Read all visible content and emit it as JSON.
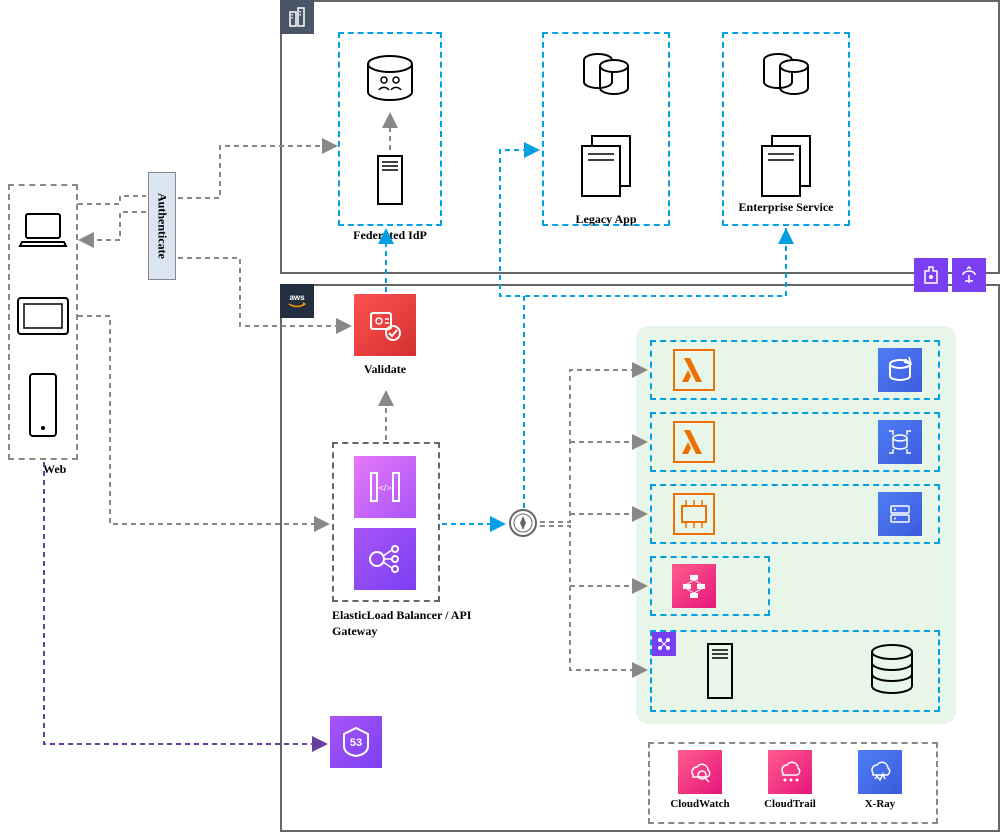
{
  "clients": {
    "label": "Web"
  },
  "authenticate": "Authenticate",
  "corporate": {
    "federatedIdp": "Federated IdP",
    "legacyApp": "Legacy App",
    "enterpriseService": "Enterprise Service"
  },
  "aws": {
    "validate": "Validate",
    "elbGateway": "ElasticLoad Balancer / API Gateway",
    "monitoring": {
      "cloudwatch": "CloudWatch",
      "cloudtrail": "CloudTrail",
      "xray": "X-Ray"
    }
  },
  "colors": {
    "grayDash": "#888",
    "blueDash": "#00a0e3",
    "purpleDash": "#6b3fa0",
    "darkBlue": "#2e3b4e",
    "red": "#e63946",
    "purple": "#7b3ff2",
    "orange": "#ed7100",
    "pink": "#e7157b",
    "blue": "#3b5bdb",
    "greenBg": "#e8f5e9"
  }
}
